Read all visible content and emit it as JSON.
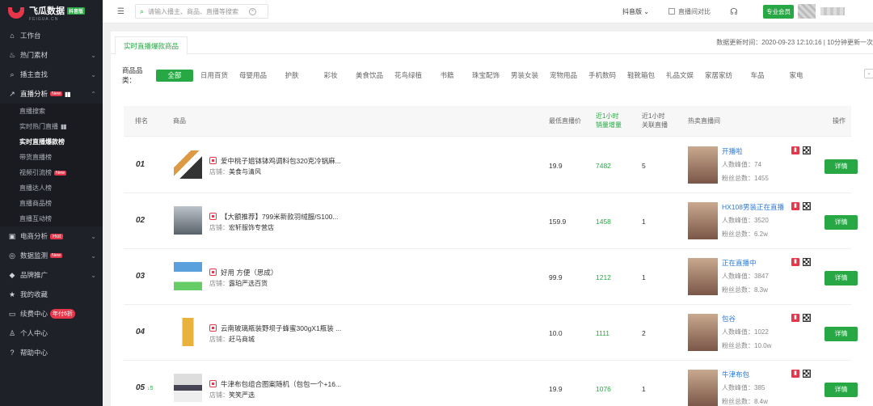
{
  "brand": {
    "title": "飞瓜数据",
    "badge": "抖音版",
    "sub": "FEIGUA.CN"
  },
  "sidebar": {
    "items": [
      {
        "label": "工作台",
        "icon": "home-icon"
      },
      {
        "label": "热门素材",
        "icon": "fire-icon",
        "chev": "⌄"
      },
      {
        "label": "播主查找",
        "icon": "search-icon",
        "chev": "⌄"
      },
      {
        "label": "直播分析",
        "icon": "trend-icon",
        "tag": "New",
        "chev": "⌃"
      }
    ],
    "sub_items": [
      {
        "label": "直播搜索"
      },
      {
        "label": "实时热门直播"
      },
      {
        "label": "实时直播爆款榜"
      },
      {
        "label": "带货直播榜"
      },
      {
        "label": "视频引流榜",
        "tag": "New"
      },
      {
        "label": "直播达人榜"
      },
      {
        "label": "直播商品榜"
      },
      {
        "label": "直播互动榜"
      }
    ],
    "bottom_items": [
      {
        "label": "电商分析",
        "tag": "Hot"
      },
      {
        "label": "数据监测",
        "tag": "New"
      },
      {
        "label": "品牌推广"
      },
      {
        "label": "我的收藏"
      },
      {
        "label": "续费中心",
        "tag": "年付6折"
      },
      {
        "label": "个人中心"
      },
      {
        "label": "帮助中心"
      }
    ]
  },
  "topbar": {
    "search_placeholder": "请输入播主、商品、直播等搜索",
    "platform": "抖音版 ⌄",
    "compare": "直播间对比",
    "vip": "专业会员"
  },
  "page": {
    "tab": "实时直播爆款商品",
    "update": "数据更新时间：2020-09-23 12:10:16 | 10分钟更新一次"
  },
  "categories": {
    "label": "商品品类：",
    "items": [
      "全部",
      "日用百货",
      "母婴用品",
      "护肤",
      "彩妆",
      "美食饮品",
      "花鸟绿植",
      "书籍",
      "珠宝配饰",
      "男装女装",
      "宠物用品",
      "手机数码",
      "鞋靴箱包",
      "礼品文娱",
      "家居家纺",
      "车品",
      "家电"
    ]
  },
  "table": {
    "headers": {
      "rank": "排名",
      "product": "商品",
      "price": "最低直播价",
      "sales_1": "近1小时",
      "sales_2": "销量增量",
      "related_1": "近1小时",
      "related_2": "关联直播",
      "hot": "热卖直播间",
      "action": "操作"
    },
    "rows": [
      {
        "rank": "01",
        "rank_up": "",
        "name": "爱中桃子姐钵钵鸡调料包320克冷锅麻...",
        "shop_label": "店铺：",
        "shop": "美食与清风",
        "price": "19.9",
        "sales": "7482",
        "related": "5",
        "anchor": "开播啦",
        "peak_label": "人数峰值：",
        "peak": "74",
        "fans_label": "粉丝总数：",
        "fans": "1455",
        "btn": "详情"
      },
      {
        "rank": "02",
        "rank_up": "",
        "name": "【大额推荐】799米新款羽绒服/S100...",
        "shop_label": "店铺：",
        "shop": "宏轩服饰专营店",
        "price": "159.9",
        "sales": "1458",
        "related": "1",
        "anchor": "HX108男装正在直播",
        "peak_label": "人数峰值：",
        "peak": "3520",
        "fans_label": "粉丝总数：",
        "fans": "6.2w",
        "btn": "详情"
      },
      {
        "rank": "03",
        "rank_up": "",
        "name": "好用 方便（思成）",
        "shop_label": "店铺：",
        "shop": "露珀严选百货",
        "price": "99.9",
        "sales": "1212",
        "related": "1",
        "anchor": "正在直播中",
        "peak_label": "人数峰值：",
        "peak": "3847",
        "fans_label": "粉丝总数：",
        "fans": "8.3w",
        "btn": "详情"
      },
      {
        "rank": "04",
        "rank_up": "",
        "name": "云南玻璃瓶装野坝子蜂蜜300gX1瓶装 ...",
        "shop_label": "店铺：",
        "shop": "赶马商城",
        "price": "10.0",
        "sales": "1111",
        "related": "2",
        "anchor": "包谷",
        "peak_label": "人数峰值：",
        "peak": "1022",
        "fans_label": "粉丝总数：",
        "fans": "10.0w",
        "btn": "详情"
      },
      {
        "rank": "05",
        "rank_up": "↓5",
        "name": "牛津布包组合图案随机（包包一个+16...",
        "shop_label": "店铺：",
        "shop": "笑笑严选",
        "price": "19.9",
        "sales": "1076",
        "related": "1",
        "anchor": "牛津布包",
        "peak_label": "人数峰值：",
        "peak": "385",
        "fans_label": "粉丝总数：",
        "fans": "8.4w",
        "btn": "详情"
      }
    ]
  }
}
